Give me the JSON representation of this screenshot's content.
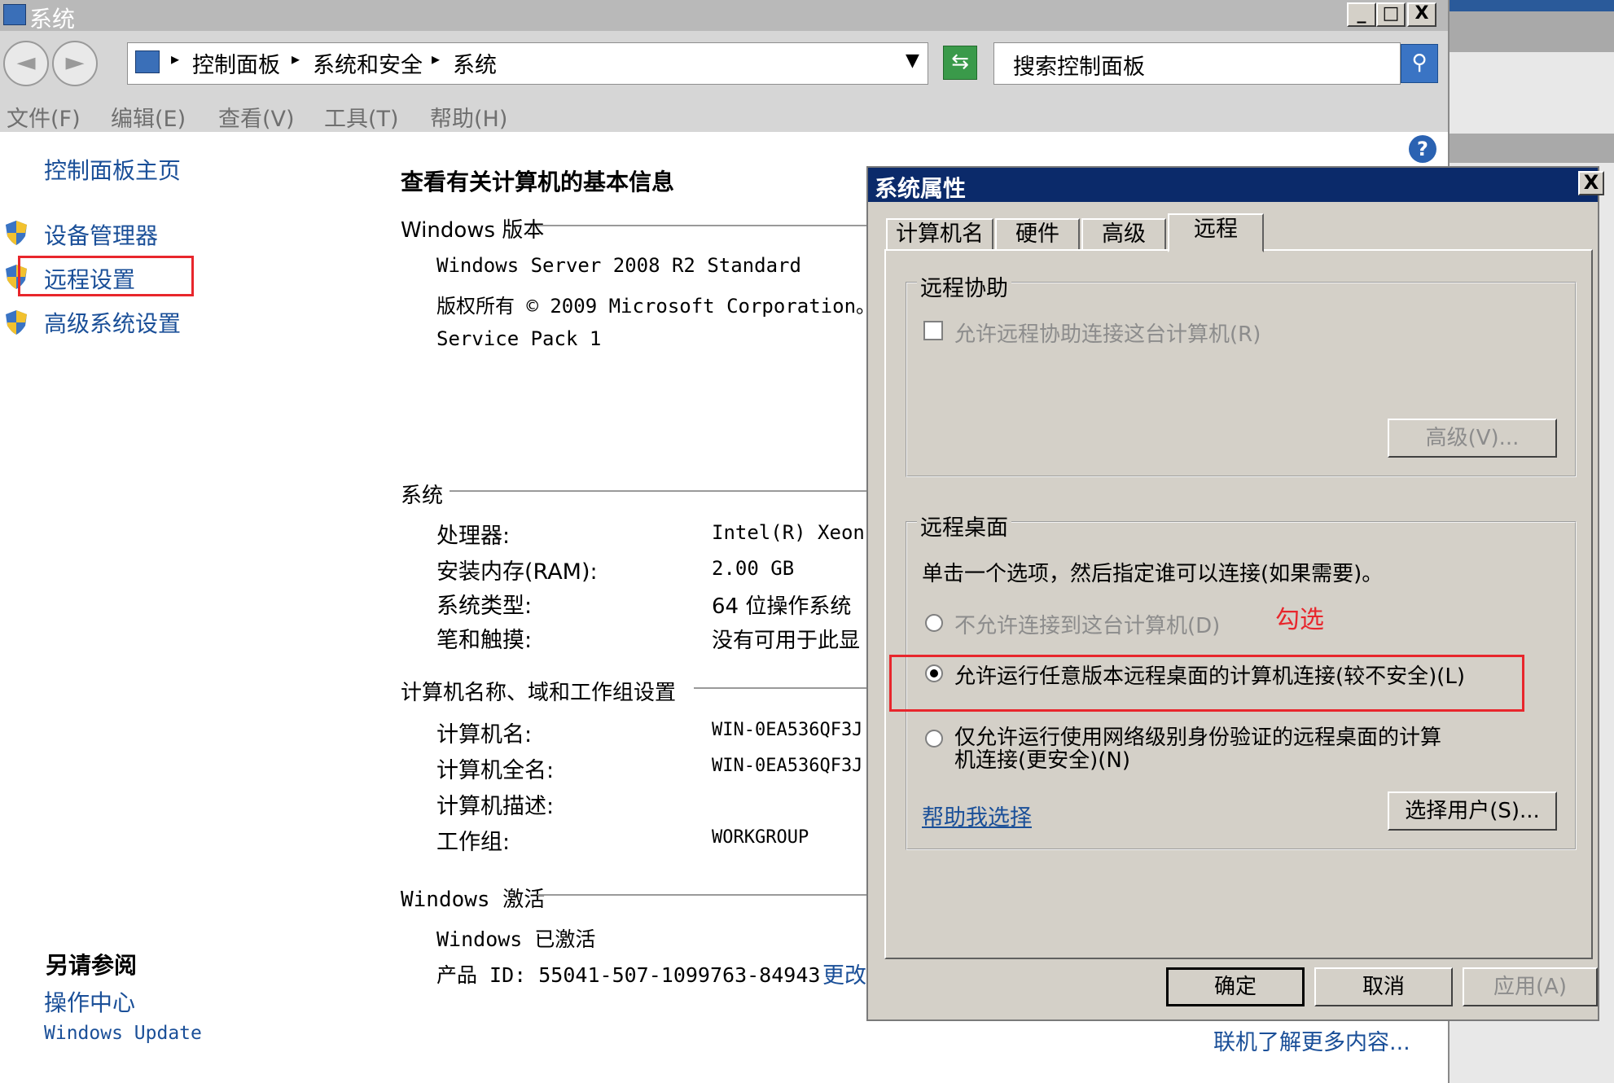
{
  "window": {
    "title": "系统",
    "min": "_",
    "max": "□",
    "close": "X"
  },
  "address": {
    "breadcrumb": [
      "控制面板",
      "系统和安全",
      "系统"
    ],
    "search_placeholder": "搜索控制面板"
  },
  "menu": [
    "文件(F)",
    "编辑(E)",
    "查看(V)",
    "工具(T)",
    "帮助(H)"
  ],
  "sidebar": {
    "home": "控制面板主页",
    "items": [
      "设备管理器",
      "远程设置",
      "高级系统设置"
    ],
    "see_also_title": "另请参阅",
    "see_also": [
      "操作中心",
      "Windows Update"
    ]
  },
  "content": {
    "heading": "查看有关计算机的基本信息",
    "edition_section": "Windows 版本",
    "edition": "Windows Server 2008 R2 Standard",
    "copyright": "版权所有 © 2009 Microsoft Corporation。",
    "service_pack": "Service Pack 1",
    "system_section": "系统",
    "system_rows": [
      {
        "label": "处理器:",
        "value": "Intel(R) Xeon("
      },
      {
        "label": "安装内存(RAM):",
        "value": "2.00 GB"
      },
      {
        "label": "系统类型:",
        "value": "64 位操作系统"
      },
      {
        "label": "笔和触摸:",
        "value": "没有可用于此显"
      }
    ],
    "name_section": "计算机名称、域和工作组设置",
    "name_rows": [
      {
        "label": "计算机名:",
        "value": "WIN-0EA536QF3J"
      },
      {
        "label": "计算机全名:",
        "value": "WIN-0EA536QF3J"
      },
      {
        "label": "计算机描述:",
        "value": ""
      },
      {
        "label": "工作组:",
        "value": "WORKGROUP"
      }
    ],
    "activation_section": "Windows 激活",
    "activation_status": "Windows 已激活",
    "product_id": "产品 ID: 55041-507-1099763-84943",
    "change_link": "更改",
    "online_more": "联机了解更多内容..."
  },
  "dialog": {
    "title": "系统属性",
    "close": "X",
    "tabs": [
      "计算机名",
      "硬件",
      "高级",
      "远程"
    ],
    "active_tab": "远程",
    "assistance": {
      "legend": "远程协助",
      "checkbox": "允许远程协助连接这台计算机(R)",
      "advanced_button": "高级(V)..."
    },
    "desktop": {
      "legend": "远程桌面",
      "instruction": "单击一个选项，然后指定谁可以连接(如果需要)。",
      "options": [
        "不允许连接到这台计算机(D)",
        "允许运行任意版本远程桌面的计算机连接(较不安全)(L)",
        "仅允许运行使用网络级别身份验证的远程桌面的计算机连接(更安全)(N)"
      ],
      "selected_option": 1,
      "help_link": "帮助我选择",
      "select_users_button": "选择用户(S)..."
    },
    "ok": "确定",
    "cancel": "取消",
    "apply": "应用(A)"
  },
  "annotation": "勾选",
  "colors": {
    "link": "#1a4f98",
    "highlight": "#e8262c",
    "dialog_title": "#0b2a6a"
  }
}
